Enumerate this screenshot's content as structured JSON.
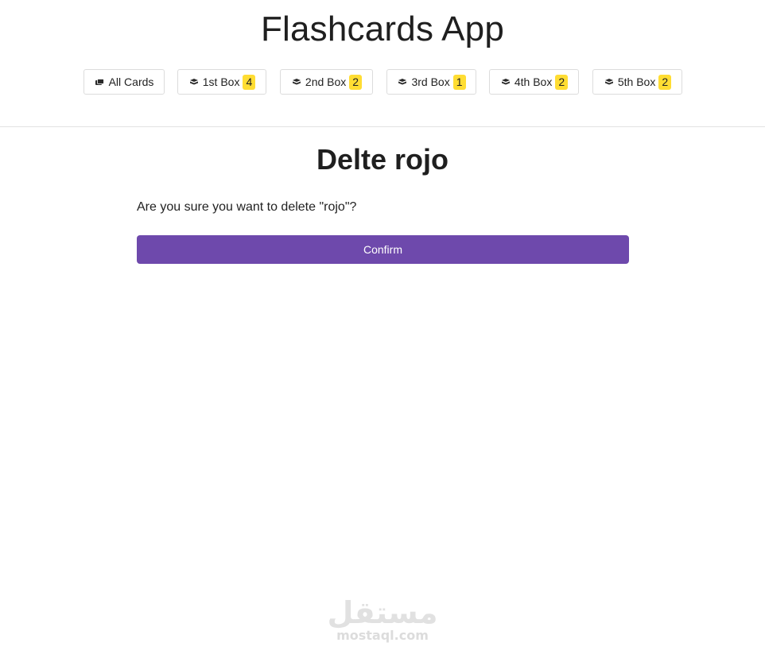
{
  "app": {
    "title": "Flashcards App"
  },
  "nav": {
    "items": [
      {
        "label": "All Cards",
        "icon": "cards-stack-icon",
        "badge": null
      },
      {
        "label": "1st Box",
        "icon": "box-icon",
        "badge": "4"
      },
      {
        "label": "2nd Box",
        "icon": "box-icon",
        "badge": "2"
      },
      {
        "label": "3rd Box",
        "icon": "box-icon",
        "badge": "1"
      },
      {
        "label": "4th Box",
        "icon": "box-icon",
        "badge": "2"
      },
      {
        "label": "5th Box",
        "icon": "box-icon",
        "badge": "2"
      }
    ]
  },
  "main": {
    "title": "Delte rojo",
    "question": "Are you sure you want to delete \"rojo\"?",
    "confirm_label": "Confirm"
  },
  "watermark": {
    "logo": "مستقل",
    "domain": "mostaql.com"
  },
  "colors": {
    "accent": "#6e49ac",
    "badge": "#ffdd33",
    "divider": "#e2e2e2"
  }
}
